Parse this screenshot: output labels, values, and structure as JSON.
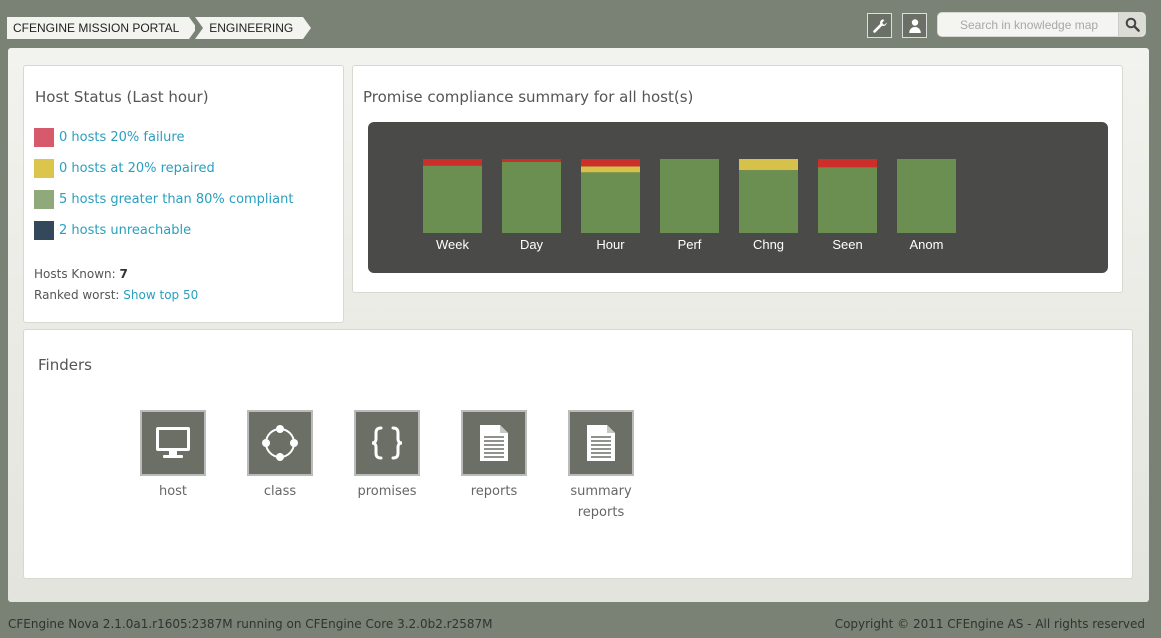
{
  "breadcrumb": [
    "CFENGINE MISSION PORTAL",
    "ENGINEERING"
  ],
  "search": {
    "placeholder": "Search in knowledge map"
  },
  "icons": {
    "tools": "wrench-icon",
    "user": "user-icon",
    "search": "search-icon"
  },
  "host_status": {
    "title": "Host Status (Last hour)",
    "items": [
      {
        "label": "0 hosts 20% failure",
        "color": "#d75a6c"
      },
      {
        "label": "0 hosts at 20% repaired",
        "color": "#dcc54c"
      },
      {
        "label": "5 hosts greater than 80% compliant",
        "color": "#8fa97b"
      },
      {
        "label": "2 hosts unreachable",
        "color": "#33495b"
      }
    ],
    "known_label": "Hosts Known:",
    "known_value": "7",
    "ranked_label": "Ranked worst:",
    "ranked_link": "Show top 50"
  },
  "compliance": {
    "title": "Promise compliance summary for all host(s)"
  },
  "chart_data": {
    "type": "bar",
    "stacked": true,
    "categories": [
      "Week",
      "Day",
      "Hour",
      "Perf",
      "Chng",
      "Seen",
      "Anom"
    ],
    "series": [
      {
        "color": "#6b8f50",
        "values": [
          91,
          96,
          82,
          100,
          85,
          89,
          100
        ]
      },
      {
        "color": "#d6c24a",
        "values": [
          0,
          0,
          8,
          0,
          15,
          0,
          0
        ]
      },
      {
        "color": "#cc2f2a",
        "values": [
          9,
          4,
          10,
          0,
          0,
          11,
          0
        ]
      }
    ],
    "ylim": [
      0,
      100
    ],
    "grid": false,
    "legend": "none"
  },
  "finders": {
    "title": "Finders",
    "items": [
      {
        "label": "host",
        "icon": "monitor-icon"
      },
      {
        "label": "class",
        "icon": "class-circle-icon"
      },
      {
        "label": "promises",
        "icon": "braces-icon"
      },
      {
        "label": "reports",
        "icon": "document-icon"
      },
      {
        "label": "summary reports",
        "icon": "document-icon"
      }
    ]
  },
  "footer": {
    "version": "CFEngine Nova 2.1.0a1.r1605:2387M running on CFEngine Core 3.2.0b2.r2587M",
    "copyright": "Copyright © 2011 CFEngine AS - All rights reserved"
  }
}
